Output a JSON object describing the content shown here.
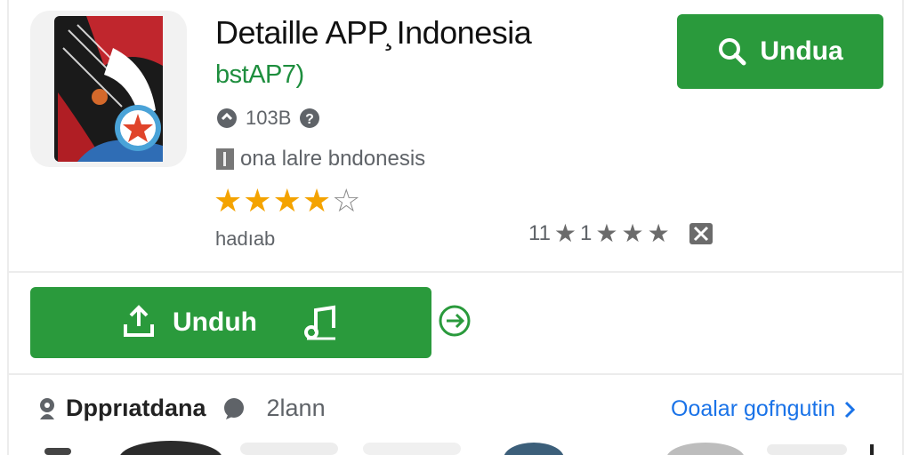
{
  "app": {
    "title": "Detaille APP̧ Indonesia",
    "developer": "bstAP7)",
    "size": "103B",
    "region": "ona lalre bndonesis",
    "rating_stars": 4,
    "rating_max": 5,
    "gift_label": "hadıab",
    "rating_counts": {
      "a": "11",
      "b": "1"
    }
  },
  "buttons": {
    "top_download": "Undua",
    "main_download": "Unduh"
  },
  "bottom": {
    "developer_label": "Dpprıatdana",
    "plan_label": "2lann",
    "see_all": "Ooalar gofngutin"
  },
  "colors": {
    "accent_green": "#2a9a3c",
    "star": "#f4a300",
    "link": "#1a73e8"
  },
  "icons": {
    "search": "search-icon",
    "upload": "upload-icon",
    "music": "music-note-icon",
    "share": "share-arrow-icon"
  }
}
